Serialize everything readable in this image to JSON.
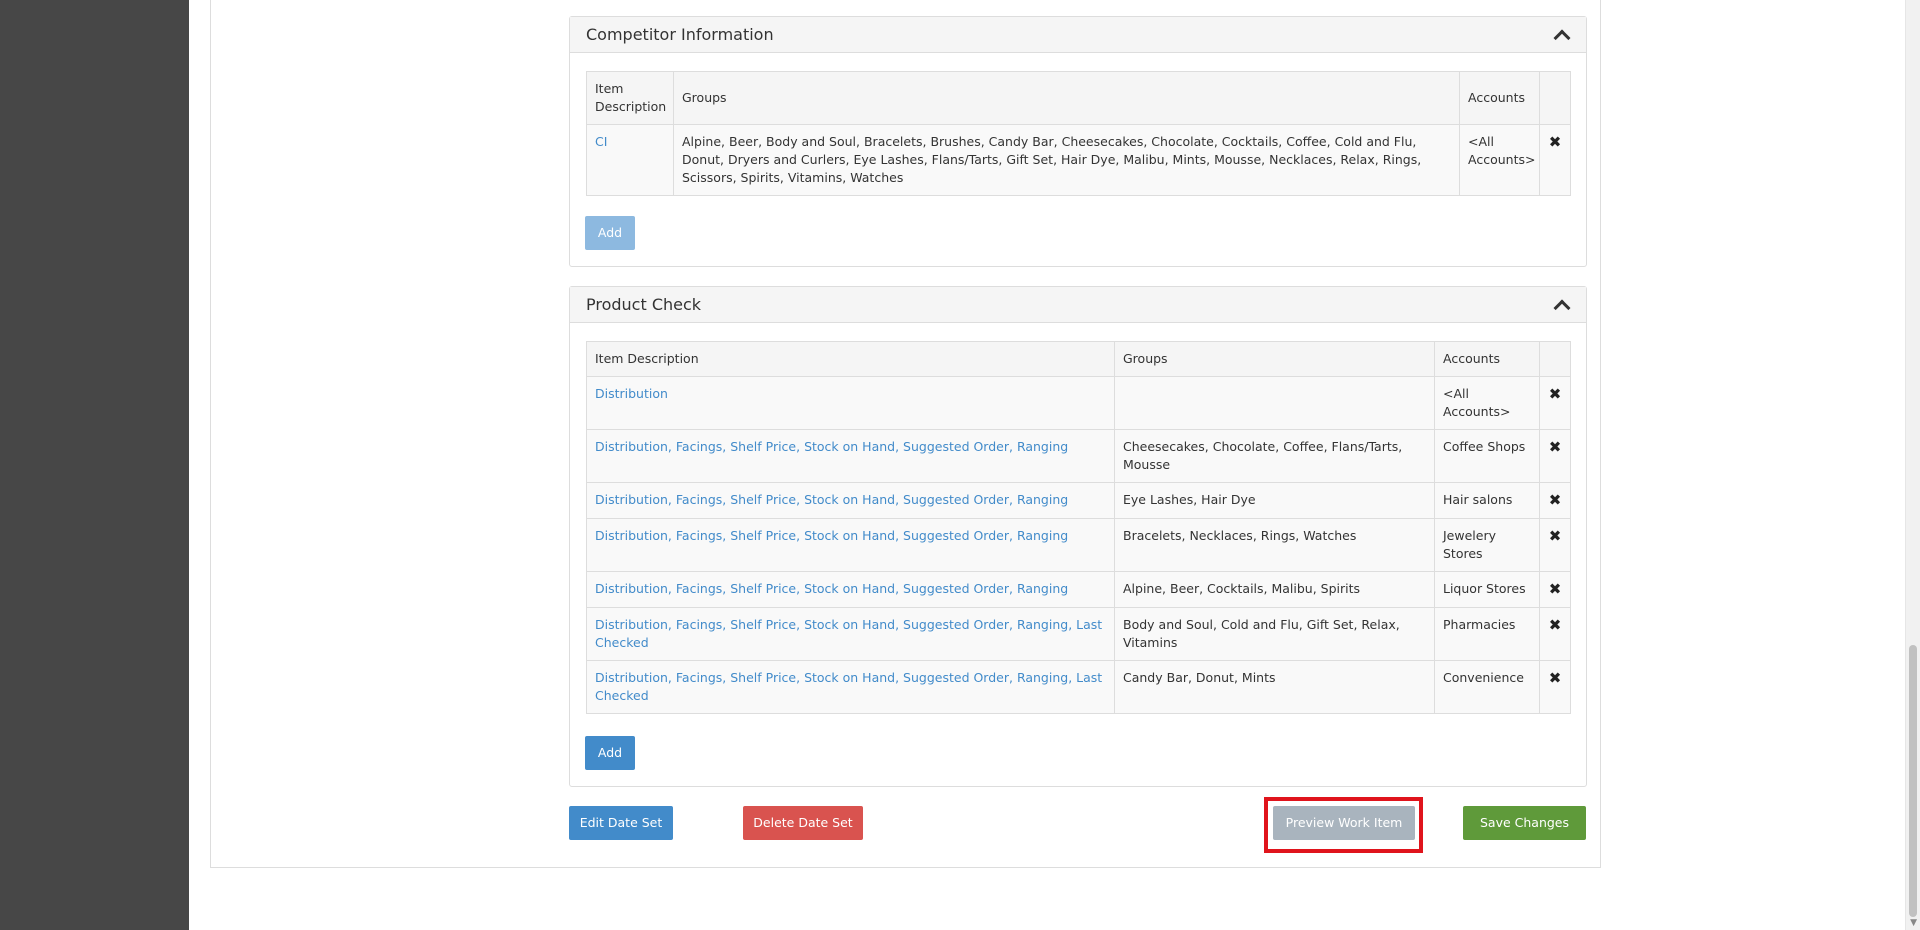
{
  "competitor": {
    "title": "Competitor Information",
    "headers": {
      "item": "Item Description",
      "groups": "Groups",
      "accounts": "Accounts"
    },
    "row": {
      "item": "CI",
      "groups": "Alpine, Beer, Body and Soul, Bracelets, Brushes, Candy Bar, Cheesecakes, Chocolate, Cocktails, Coffee, Cold and Flu, Donut, Dryers and Curlers, Eye Lashes, Flans/Tarts, Gift Set, Hair Dye, Malibu, Mints, Mousse, Necklaces, Relax, Rings, Scissors, Spirits, Vitamins, Watches",
      "accounts": "<All Accounts>"
    },
    "add_label": "Add"
  },
  "product_check": {
    "title": "Product Check",
    "headers": {
      "item": "Item Description",
      "groups": "Groups",
      "accounts": "Accounts"
    },
    "rows": [
      {
        "item": "Distribution",
        "groups": "",
        "accounts": "<All Accounts>"
      },
      {
        "item": "Distribution, Facings, Shelf Price, Stock on Hand, Suggested Order, Ranging",
        "groups": "Cheesecakes, Chocolate, Coffee, Flans/Tarts, Mousse",
        "accounts": "Coffee Shops"
      },
      {
        "item": "Distribution, Facings, Shelf Price, Stock on Hand, Suggested Order, Ranging",
        "groups": "Eye Lashes, Hair Dye",
        "accounts": "Hair salons"
      },
      {
        "item": "Distribution, Facings, Shelf Price, Stock on Hand, Suggested Order, Ranging",
        "groups": "Bracelets, Necklaces, Rings, Watches",
        "accounts": "Jewelery Stores"
      },
      {
        "item": "Distribution, Facings, Shelf Price, Stock on Hand, Suggested Order, Ranging",
        "groups": "Alpine, Beer, Cocktails, Malibu, Spirits",
        "accounts": "Liquor Stores"
      },
      {
        "item": "Distribution, Facings, Shelf Price, Stock on Hand, Suggested Order, Ranging, Last Checked",
        "groups": "Body and Soul, Cold and Flu, Gift Set, Relax, Vitamins",
        "accounts": "Pharmacies"
      },
      {
        "item": "Distribution, Facings, Shelf Price, Stock on Hand, Suggested Order, Ranging, Last Checked",
        "groups": "Candy Bar, Donut, Mints",
        "accounts": "Convenience"
      }
    ],
    "add_label": "Add"
  },
  "actions": {
    "edit": "Edit Date Set",
    "delete": "Delete Date Set",
    "preview": "Preview Work Item",
    "save": "Save Changes"
  },
  "icons": {
    "collapse": "chevron-up-icon",
    "delete": "close-icon"
  },
  "colors": {
    "link": "#428bca",
    "primary": "#428bca",
    "danger": "#d9534f",
    "success": "#5f9a3a",
    "highlight": "#e0141c"
  }
}
